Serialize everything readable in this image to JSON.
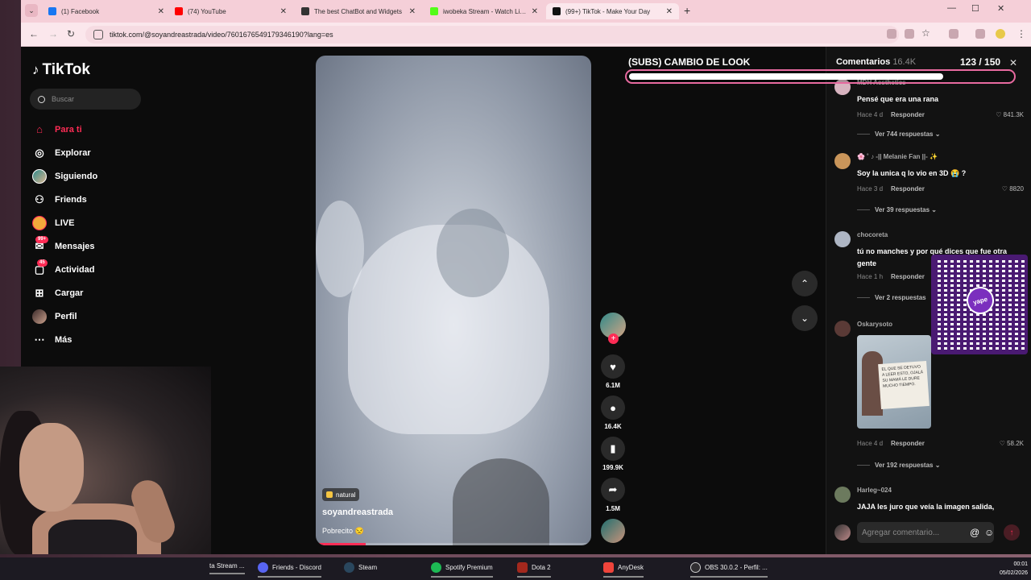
{
  "browser": {
    "tabs": [
      {
        "title": "(1) Facebook",
        "color": "#1877f2"
      },
      {
        "title": "(74) YouTube",
        "color": "#ff0000"
      },
      {
        "title": "The best ChatBot and Widgets",
        "color": "#333333"
      },
      {
        "title": "iwobeka Stream - Watch Live o",
        "color": "#53fc18"
      },
      {
        "title": "(99+) TikTok - Make Your Day",
        "color": "#111111"
      }
    ],
    "url": "tiktok.com/@soyandreastrada/video/7601676549179346190?lang=es"
  },
  "sidebar": {
    "logo": "TikTok",
    "search_placeholder": "Buscar",
    "items": [
      {
        "label": "Para ti",
        "icon": "home-icon",
        "glyph": "⌂"
      },
      {
        "label": "Explorar",
        "icon": "compass-icon",
        "glyph": "◎"
      },
      {
        "label": "Siguiendo",
        "icon": "following-avatar-icon",
        "glyph": "●"
      },
      {
        "label": "Friends",
        "icon": "friends-icon",
        "glyph": "⚇"
      },
      {
        "label": "LIVE",
        "icon": "live-icon",
        "glyph": "●"
      },
      {
        "label": "Mensajes",
        "icon": "messages-icon",
        "glyph": "✉",
        "badge": "99+"
      },
      {
        "label": "Actividad",
        "icon": "activity-icon",
        "glyph": "▢",
        "badge": "45"
      },
      {
        "label": "Cargar",
        "icon": "upload-icon",
        "glyph": "⊞"
      },
      {
        "label": "Perfil",
        "icon": "profile-icon",
        "glyph": "●"
      },
      {
        "label": "Más",
        "icon": "more-icon",
        "glyph": "⋯"
      }
    ]
  },
  "video": {
    "tag": "natural",
    "author": "soyandreastrada",
    "description": "Pobrecito 😒",
    "progress": 0.18,
    "likes": "6.1M",
    "comments": "16.4K",
    "saves": "199.9K",
    "shares": "1.5M"
  },
  "overlay": {
    "goal_title": "(SUBS) CAMBIO DE LOOK",
    "goal_count": "123  / 150",
    "goal_fraction": 0.82
  },
  "comments_panel": {
    "title": "Comentarios",
    "count": "16.4K",
    "input_placeholder": "Agregar comentario...",
    "items": [
      {
        "user": "MDH Aesthetics",
        "text": "Pensé que era una rana",
        "time": "Hace 4 d",
        "reply": "Responder",
        "likes": "841.3K",
        "replies": "Ver 744 respuestas ⌄"
      },
      {
        "user": "🌸 ˚ ♪ -|| Melanie Fan ||- ✨",
        "text": "Soy la unica q lo vio en 3D 😭 ?",
        "time": "Hace 3 d",
        "reply": "Responder",
        "likes": "8820",
        "replies": "Ver 39 respuestas ⌄"
      },
      {
        "user": "chocoreta",
        "text": "tú no manches y por qué dices que fue otra gente",
        "time": "Hace 1 h",
        "reply": "Responder",
        "likes": "",
        "replies": "Ver 2 respuestas"
      },
      {
        "user": "Oskarysoto",
        "text": "",
        "time": "Hace 4 d",
        "reply": "Responder",
        "likes": "58.2K",
        "replies": "Ver 192 respuestas ⌄",
        "image_caption": "EL QUE SE DETUVO A LEER ESTO, OJALÁ SU MAMÁ LE DURE MUCHO TIEMPO."
      },
      {
        "user": "Harleg~024",
        "text": "JAJA les juro que veía la imagen salida,",
        "time": "",
        "reply": "",
        "likes": "",
        "replies": ""
      }
    ],
    "qr_label": "yape"
  },
  "taskbar": {
    "items": [
      {
        "label": "ta Stream ...",
        "color": "#53fc18"
      },
      {
        "label": "Friends - Discord",
        "color": "#5865f2"
      },
      {
        "label": "Steam",
        "color": "#1b2838"
      },
      {
        "label": "Spotify Premium",
        "color": "#1db954"
      },
      {
        "label": "Dota 2",
        "color": "#a3281d"
      },
      {
        "label": "AnyDesk",
        "color": "#ef443b"
      },
      {
        "label": "OBS 30.0.2 - Perfil: ...",
        "color": "#302e31"
      }
    ],
    "time": "00:01",
    "date": "05/02/2026"
  }
}
